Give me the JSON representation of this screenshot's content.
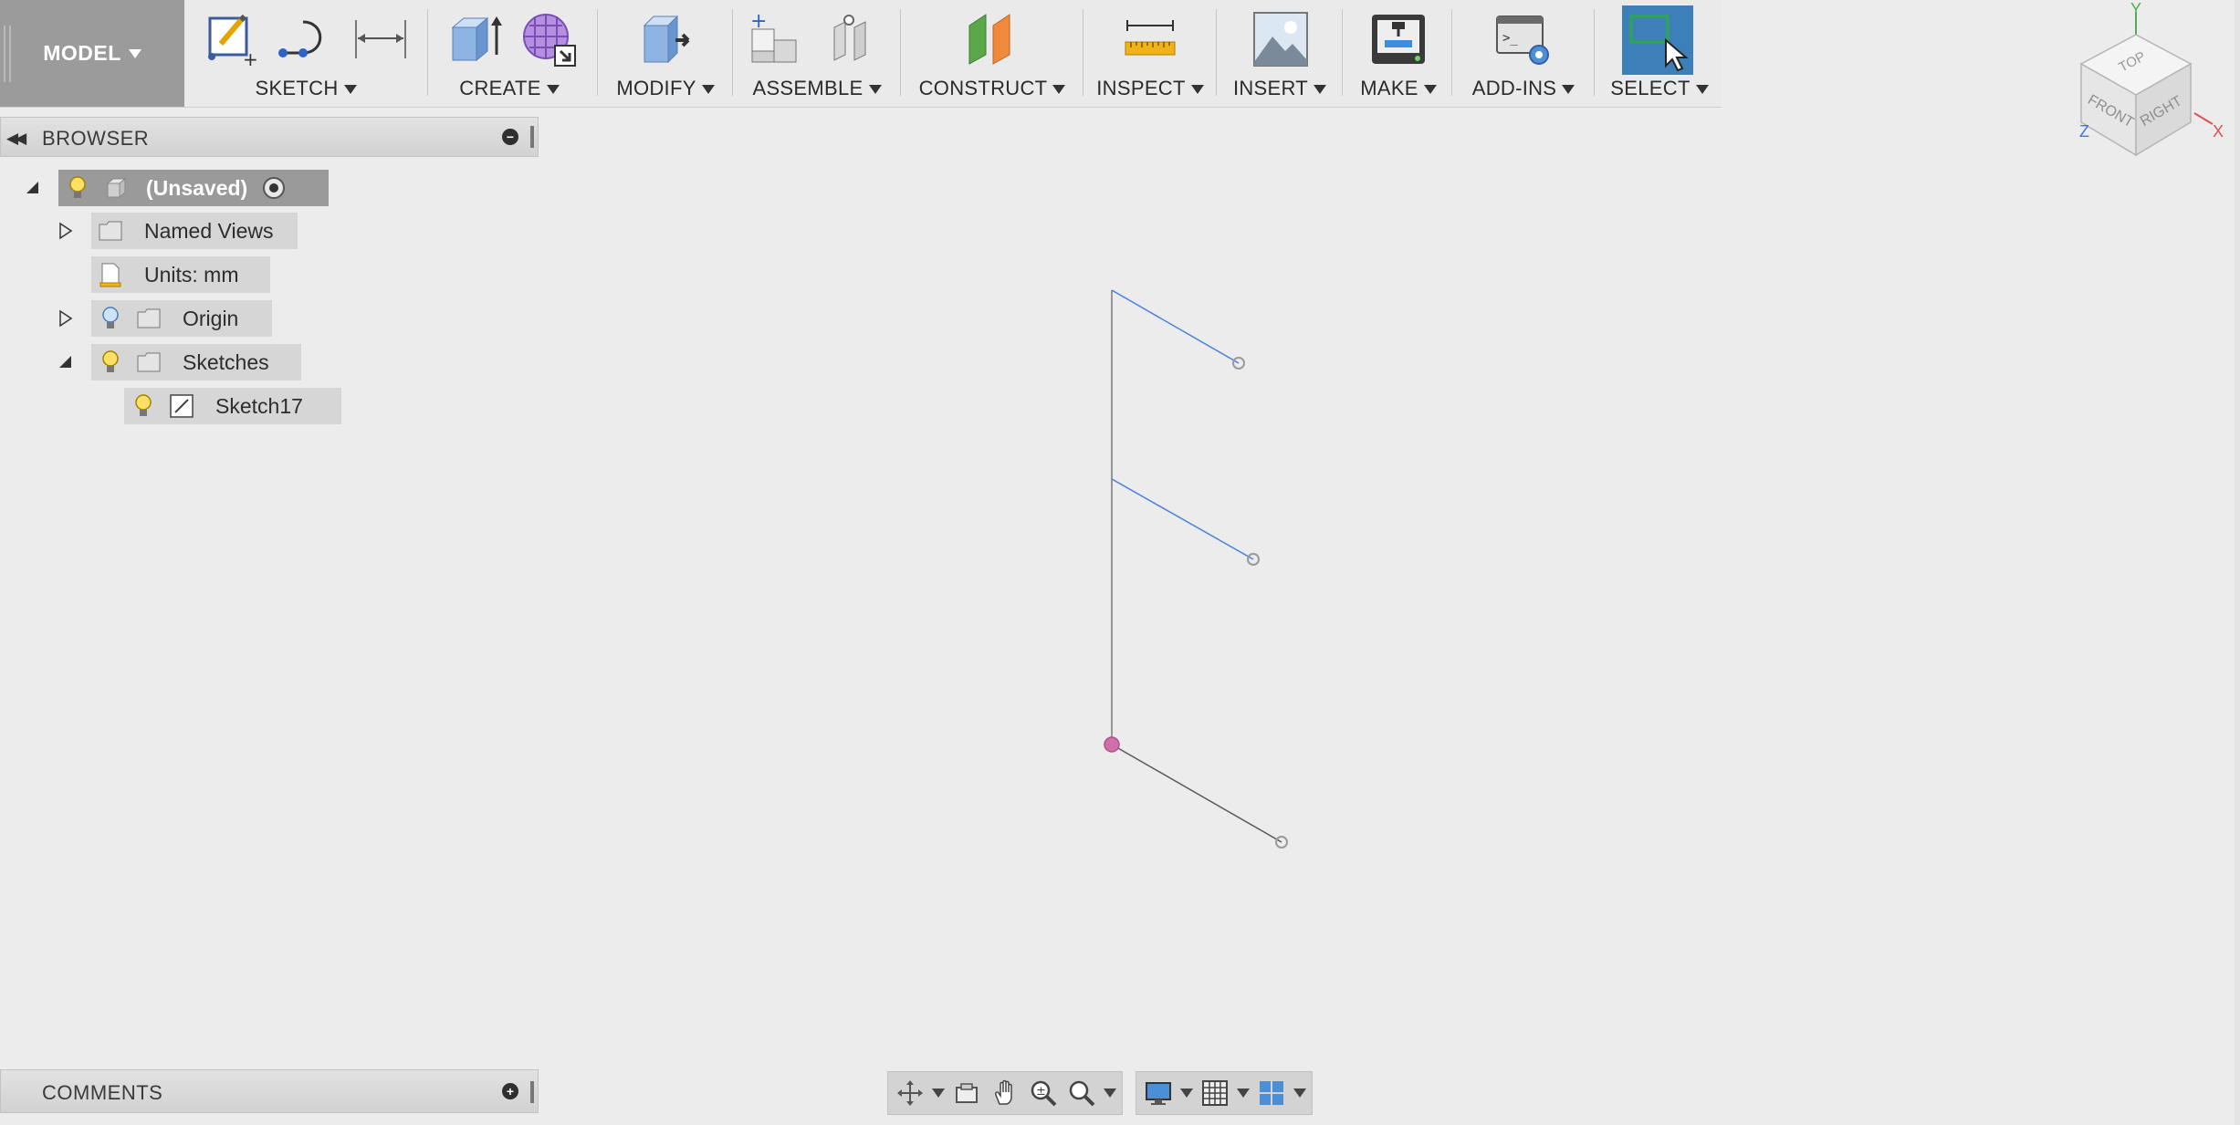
{
  "toolbar": {
    "mode_label": "MODEL",
    "groups": [
      {
        "label": "SKETCH"
      },
      {
        "label": "CREATE"
      },
      {
        "label": "MODIFY"
      },
      {
        "label": "ASSEMBLE"
      },
      {
        "label": "CONSTRUCT"
      },
      {
        "label": "INSPECT"
      },
      {
        "label": "INSERT"
      },
      {
        "label": "MAKE"
      },
      {
        "label": "ADD-INS"
      },
      {
        "label": "SELECT"
      }
    ],
    "icons": [
      "create-sketch-icon",
      "spline-icon",
      "dimension-icon",
      "extrude-icon",
      "insert-mesh-icon",
      "press-pull-icon",
      "new-component-icon",
      "joint-icon",
      "offset-plane-icon",
      "measure-icon",
      "insert-image-icon",
      "3d-print-icon",
      "scripts-icon",
      "select-icon"
    ]
  },
  "browser": {
    "title": "BROWSER",
    "items": [
      {
        "label": "(Unsaved)",
        "level": 0
      },
      {
        "label": "Named Views",
        "level": 1
      },
      {
        "label": "Units: mm",
        "level": 1
      },
      {
        "label": "Origin",
        "level": 1
      },
      {
        "label": "Sketches",
        "level": 1
      },
      {
        "label": "Sketch17",
        "level": 2
      }
    ]
  },
  "comments": {
    "title": "COMMENTS"
  },
  "viewcube": {
    "top": "TOP",
    "front": "FRONT",
    "right": "RIGHT",
    "axis_x": "X",
    "axis_y": "Y",
    "axis_z": "Z"
  },
  "colors": {
    "accent_select": "#3d7fb8",
    "sketch_line_blue": "#4a7fe0",
    "sketch_line_gray": "#7a7a7a",
    "origin_point": "#d070a8"
  }
}
